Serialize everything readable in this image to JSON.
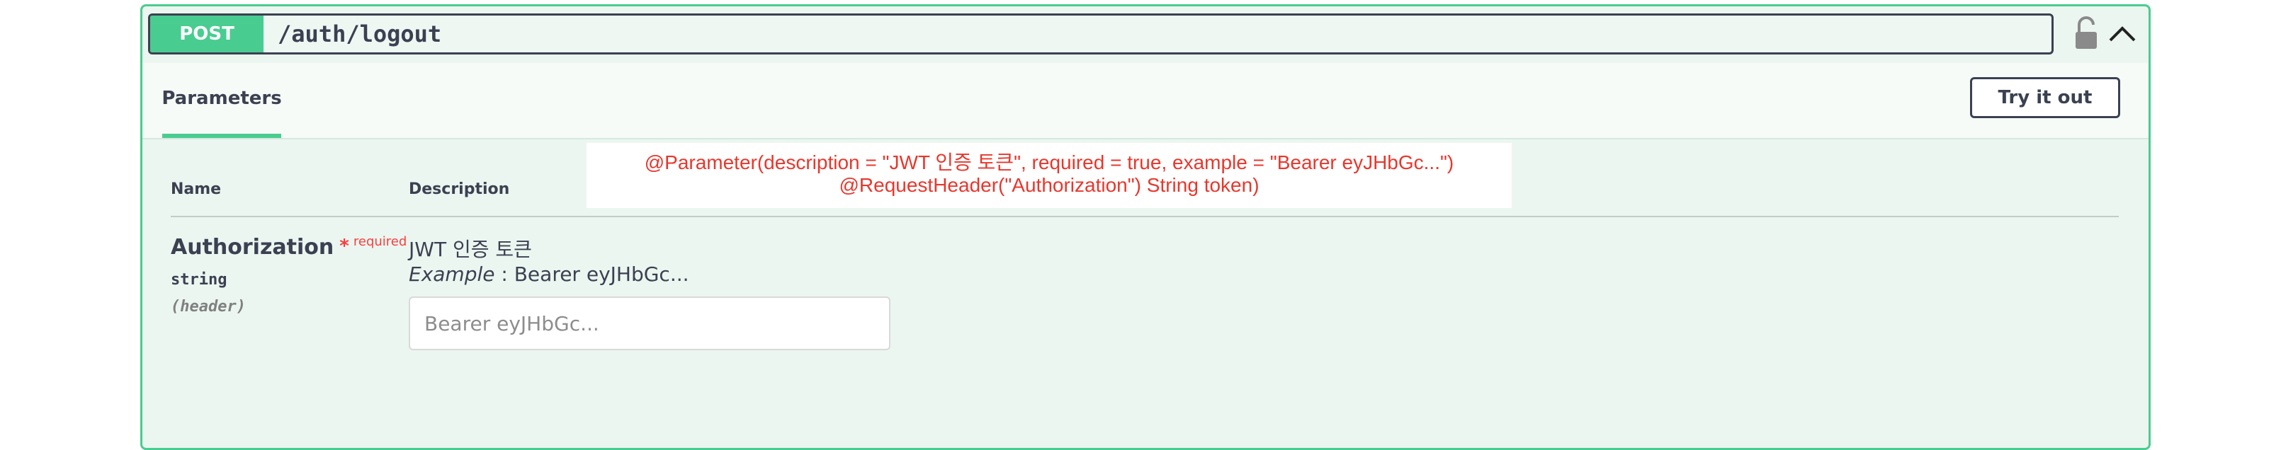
{
  "operation": {
    "method": "POST",
    "path": "/auth/logout"
  },
  "icons": {
    "lock": "lock-open-icon",
    "collapse": "chevron-up-icon"
  },
  "colors": {
    "post_green": "#49cc90",
    "block_bg": "#ecf6f0",
    "required_red": "#f93e3e",
    "annotation_red": "#e8372c"
  },
  "tabs": {
    "parameters_label": "Parameters",
    "try_button": "Try it out"
  },
  "table": {
    "headers": {
      "name": "Name",
      "description": "Description"
    },
    "annotation": "@Parameter(description = \"JWT 인증 토큰\", required = true, example = \"Bearer eyJHbGc...\") @RequestHeader(\"Authorization\") String token)",
    "parameter": {
      "name": "Authorization",
      "asterisk": "*",
      "required": "required",
      "type": "string",
      "in": "(header)",
      "description": "JWT 인증 토큰",
      "example_label": "Example",
      "example_value": " : Bearer eyJHbGc...",
      "input_placeholder": "Bearer eyJHbGc..."
    }
  }
}
